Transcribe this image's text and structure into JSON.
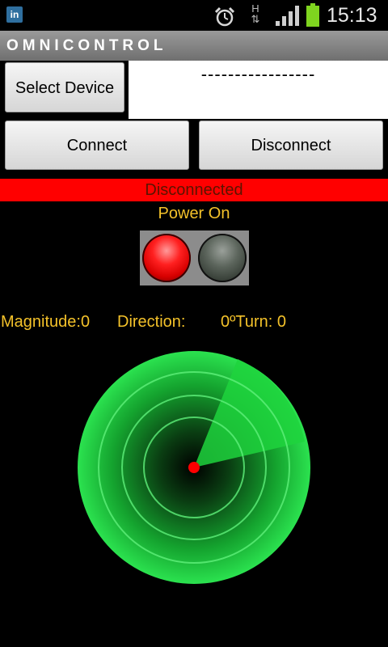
{
  "status_bar": {
    "time": "15:13",
    "notification_icon": "linkedin-icon",
    "network_type": "H",
    "icons": [
      "linkedin-icon",
      "alarm-clock-icon",
      "network-h-icon",
      "signal-icon",
      "battery-icon"
    ],
    "battery_color": "#7fd41f"
  },
  "app": {
    "title": "OMNICONTROL"
  },
  "device": {
    "select_label": "Select Device",
    "selected_value": "-----------------"
  },
  "controls": {
    "connect_label": "Connect",
    "disconnect_label": "Disconnect"
  },
  "connection": {
    "status": "Disconnected",
    "status_color": "#ff0000"
  },
  "power": {
    "label": "Power On",
    "red_led_on": true,
    "green_led_on": false
  },
  "readouts": {
    "magnitude": "Magnitude:0",
    "direction": "Direction:",
    "turn": "0ºTurn: 0"
  },
  "joystick": {
    "accent_color": "#19c93a",
    "center_dot_color": "#ff0000"
  }
}
